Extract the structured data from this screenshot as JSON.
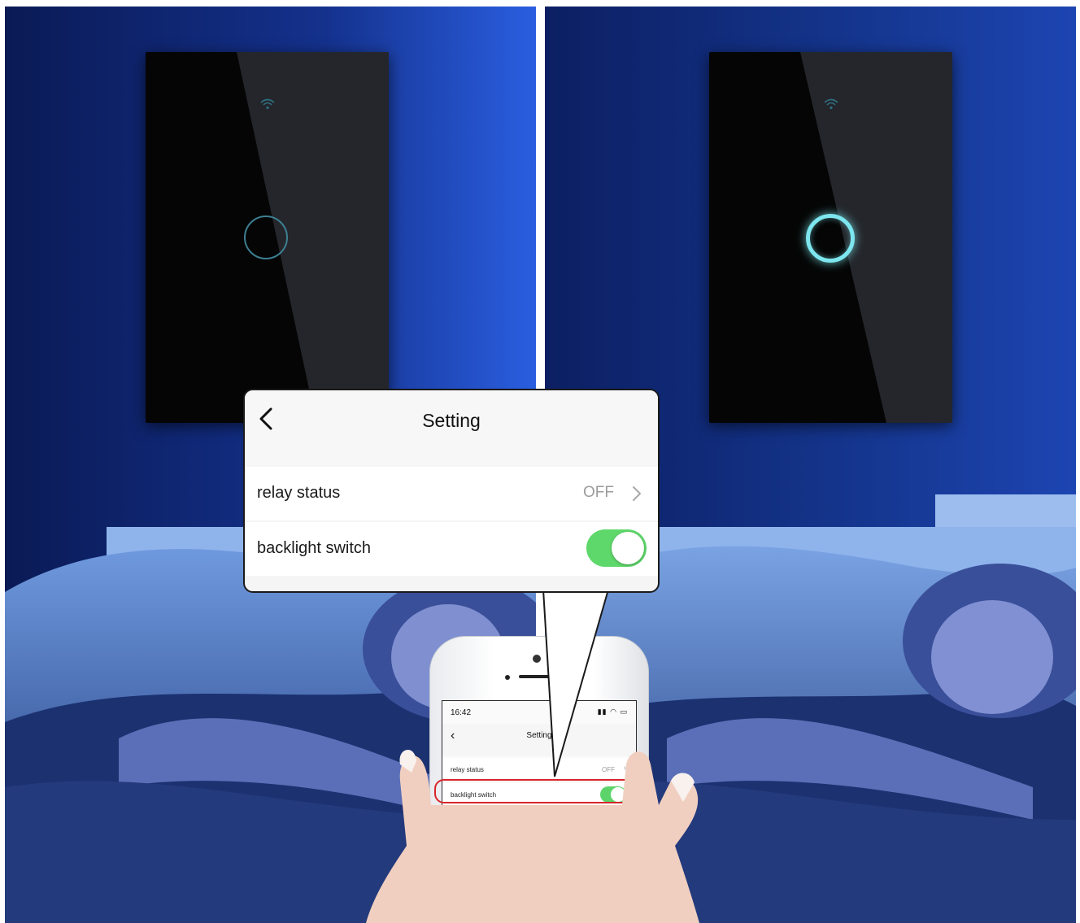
{
  "colors": {
    "night_blue": "#1c3a9a",
    "ring_dim": "#3d7f92",
    "ring_lit": "#7de6ee",
    "toggle_on": "#5fd86b",
    "highlight_red": "#d9262c"
  },
  "switch_left": {
    "backlight": "off",
    "wifi_icon": "wifi-icon"
  },
  "switch_right": {
    "backlight": "on",
    "wifi_icon": "wifi-icon"
  },
  "callout": {
    "back_icon": "chevron-left-icon",
    "title": "Setting",
    "rows": [
      {
        "label": "relay status",
        "value": "OFF",
        "icon": "chevron-right-icon"
      },
      {
        "label": "backlight switch",
        "toggle": "on"
      }
    ]
  },
  "phone": {
    "time": "16:42",
    "status_icons": "signal wifi battery",
    "back_icon": "chevron-left-icon",
    "title": "Setting",
    "rows": [
      {
        "label": "relay status",
        "value": "OFF"
      },
      {
        "label": "backlight switch",
        "toggle": "on",
        "highlighted": true
      }
    ]
  }
}
